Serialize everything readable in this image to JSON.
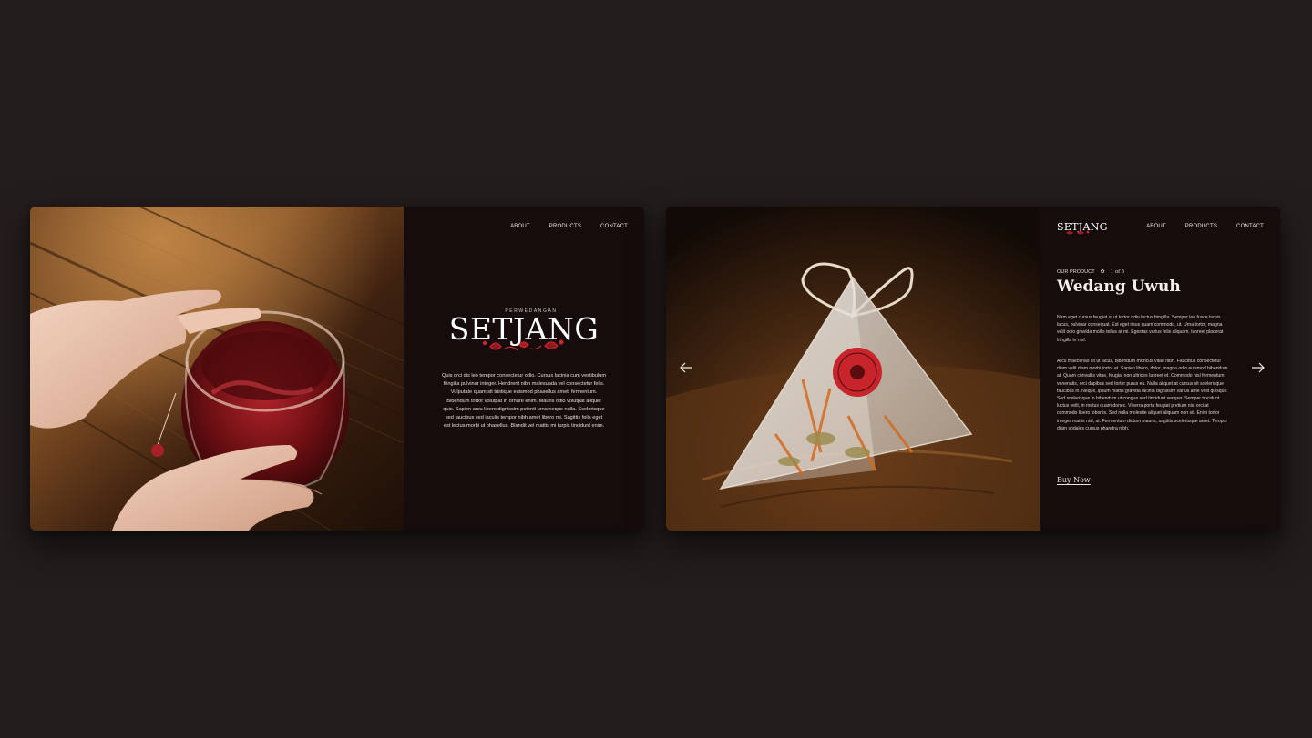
{
  "colors": {
    "background": "#231d1d",
    "panel": "#170c0c",
    "accent_red": "#c8242b",
    "text": "#ece5e0"
  },
  "left_card": {
    "nav": {
      "about": "ABOUT",
      "products": "PRODUCTS",
      "contact": "CONTACT"
    },
    "brand": {
      "subtitle": "PERWEDANGAN",
      "name": "SETJANG"
    },
    "body": "Quis orci dis leo tempor consectetur odio. Cursus lacinia cum vestibulum fringilla pulvinar integer. Hendrerit nibh malesuada vel consectetur felis. Vulputate quam sit tristique euismod phasellus amet, fermentum. Bibendum tortor volutpat in ornare enim. Mauris odio volutpat aliquet quis. Sapien arcu libero dignissim potenti urna neque nulla. Scelerisque sed faucibus sed iaculis tempor nibh amet libero mi. Sagittis felis eget est lectus morbi ut phasellus. Blandit vel mattis mi turpis tincidunt enim.",
    "photo_icon": "tea-glass-photo"
  },
  "right_card": {
    "logo": "SETJANG",
    "nav": {
      "about": "ABOUT",
      "products": "PRODUCTS",
      "contact": "CONTACT"
    },
    "kicker": "OUR PRODUCT",
    "counter": "1 of 5",
    "title": "Wedang Uwuh",
    "paragraph1": "Nam eget cursus feugiat ut ut tortor odio luctus fringilla. Semper leo fusce turpis lacus, pulvinar consequat. Est eget risus quam commodo, ut. Urna tortor, magna velit odio gravida mollis tellus at mi. Egestas varius felis aliquam, laoreet placerat fringilla in nisl.",
    "paragraph2": "Arcu maecenas sit ut lacus, bibendum rhoncus vitae nibh. Faucibus consectetur diam velit diam morbi tortor at. Sapien libero, dolor, magna odio euismod bibendum at. Quam convallis vitae, feugiat non ultrices laoreet et. Commodo nisl fermentum venenatis, orci dapibus sed tortor purus eu. Nulla aliquet at cursus sit scelerisque faucibus in. Neque, ipsum mattis gravida lacinia dignissim varius ante velit quisque. Sed scelerisque in bibendum ut congue sed tincidunt semper. Semper tincidunt luctus velit, in metus quam donec. Viverra porta feugiat pretium nisi orci at commodo libero lobortis. Sed nulla molestie aliquet aliquam non sit. Enim tortor integer mattis nisl, ut. Fermentum dictum mauris, sagittis scelerisque amet. Tempor diam sodales cursus pharetra nibh.",
    "cta": "Buy Now",
    "icons": {
      "prev": "arrow-left-icon",
      "next": "arrow-right-icon",
      "leaf": "leaf-icon"
    }
  }
}
